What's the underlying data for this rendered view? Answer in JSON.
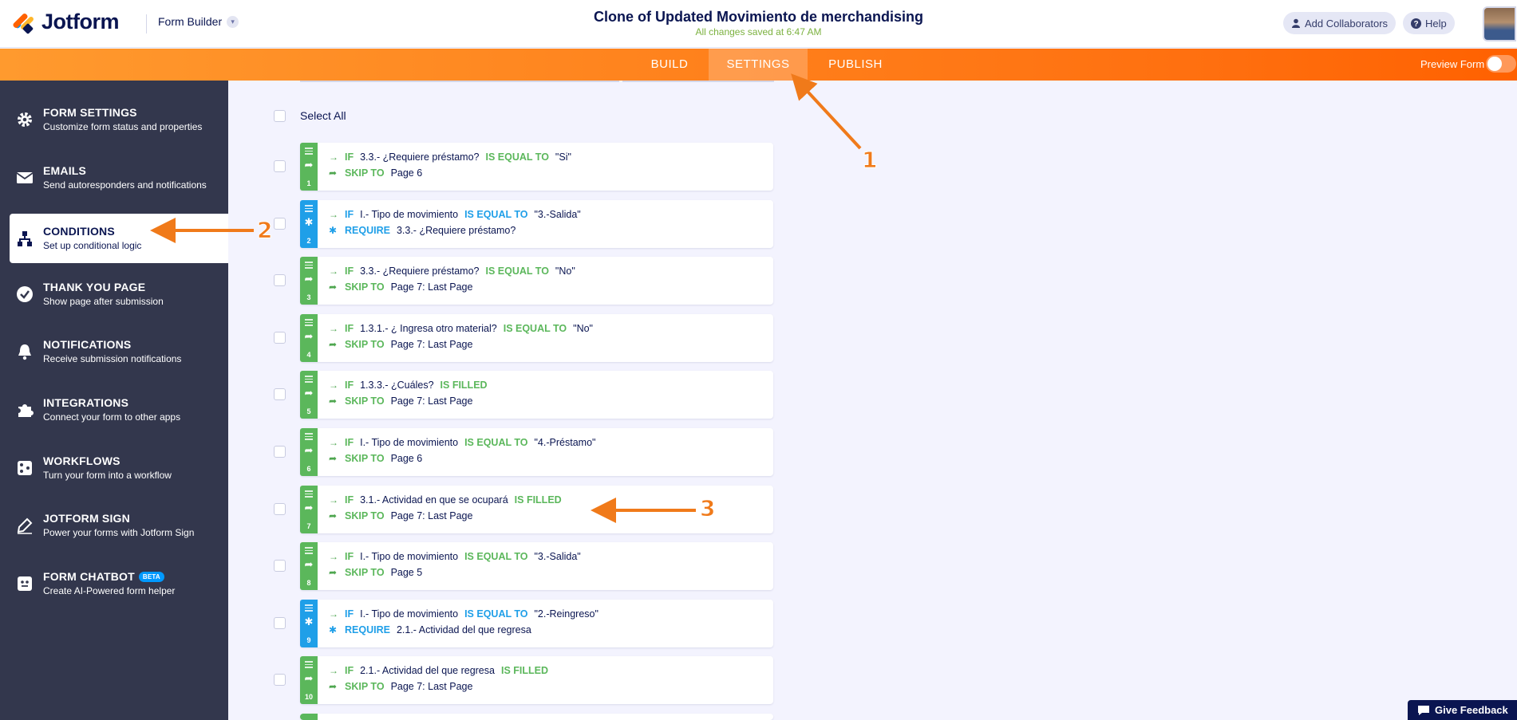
{
  "header": {
    "logo_text": "Jotform",
    "builder_label": "Form Builder",
    "form_title": "Clone of Updated Movimiento de merchandising",
    "saved_status": "All changes saved at 6:47 AM",
    "add_collaborators": "Add Collaborators",
    "help": "Help"
  },
  "nav": {
    "tabs": [
      "BUILD",
      "SETTINGS",
      "PUBLISH"
    ],
    "active_tab": "SETTINGS",
    "preview_label": "Preview Form"
  },
  "sidebar": {
    "items": [
      {
        "title": "FORM SETTINGS",
        "subtitle": "Customize form status and properties",
        "icon": "gear-icon"
      },
      {
        "title": "EMAILS",
        "subtitle": "Send autoresponders and notifications",
        "icon": "envelope-icon"
      },
      {
        "title": "CONDITIONS",
        "subtitle": "Set up conditional logic",
        "icon": "sitemap-icon"
      },
      {
        "title": "THANK YOU PAGE",
        "subtitle": "Show page after submission",
        "icon": "check-circle-icon"
      },
      {
        "title": "NOTIFICATIONS",
        "subtitle": "Receive submission notifications",
        "icon": "bell-icon"
      },
      {
        "title": "INTEGRATIONS",
        "subtitle": "Connect your form to other apps",
        "icon": "puzzle-icon"
      },
      {
        "title": "WORKFLOWS",
        "subtitle": "Turn your form into a workflow",
        "icon": "workflow-icon"
      },
      {
        "title": "JOTFORM SIGN",
        "subtitle": "Power your forms with Jotform Sign",
        "icon": "pen-icon"
      },
      {
        "title": "FORM CHATBOT",
        "subtitle": "Create AI-Powered form helper",
        "icon": "chatbot-icon",
        "badge": "BETA"
      }
    ],
    "active_item": "CONDITIONS"
  },
  "main": {
    "select_all": "Select All",
    "conditions": [
      {
        "num": "1",
        "type": "skip",
        "if_kw": "IF",
        "field": "3.3.- ¿Requiere préstamo?",
        "op": "IS EQUAL TO",
        "value": "\"Si\"",
        "action": "SKIP TO",
        "target": "Page 6"
      },
      {
        "num": "2",
        "type": "require",
        "if_kw": "IF",
        "field": "I.- Tipo de movimiento",
        "op": "IS EQUAL TO",
        "value": "\"3.-Salida\"",
        "action": "REQUIRE",
        "target": "3.3.- ¿Requiere préstamo?"
      },
      {
        "num": "3",
        "type": "skip",
        "if_kw": "IF",
        "field": "3.3.- ¿Requiere préstamo?",
        "op": "IS EQUAL TO",
        "value": "\"No\"",
        "action": "SKIP TO",
        "target": "Page 7: Last Page"
      },
      {
        "num": "4",
        "type": "skip",
        "if_kw": "IF",
        "field": "1.3.1.- ¿ Ingresa otro material?",
        "op": "IS EQUAL TO",
        "value": "\"No\"",
        "action": "SKIP TO",
        "target": "Page 7: Last Page"
      },
      {
        "num": "5",
        "type": "skip",
        "if_kw": "IF",
        "field": "1.3.3.- ¿Cuáles?",
        "op": "IS FILLED",
        "value": "",
        "action": "SKIP TO",
        "target": "Page 7: Last Page"
      },
      {
        "num": "6",
        "type": "skip",
        "if_kw": "IF",
        "field": "I.- Tipo de movimiento",
        "op": "IS EQUAL TO",
        "value": "\"4.-Préstamo\"",
        "action": "SKIP TO",
        "target": "Page 6"
      },
      {
        "num": "7",
        "type": "skip",
        "if_kw": "IF",
        "field": "3.1.- Actividad en que se ocupará",
        "op": "IS FILLED",
        "value": "",
        "action": "SKIP TO",
        "target": "Page 7: Last Page"
      },
      {
        "num": "8",
        "type": "skip",
        "if_kw": "IF",
        "field": "I.- Tipo de movimiento",
        "op": "IS EQUAL TO",
        "value": "\"3.-Salida\"",
        "action": "SKIP TO",
        "target": "Page 5"
      },
      {
        "num": "9",
        "type": "require",
        "if_kw": "IF",
        "field": "I.- Tipo de movimiento",
        "op": "IS EQUAL TO",
        "value": "\"2.-Reingreso\"",
        "action": "REQUIRE",
        "target": "2.1.- Actividad del que regresa"
      },
      {
        "num": "10",
        "type": "skip",
        "if_kw": "IF",
        "field": "2.1.- Actividad del que regresa",
        "op": "IS FILLED",
        "value": "",
        "action": "SKIP TO",
        "target": "Page 7: Last Page"
      }
    ]
  },
  "feedback": "Give Feedback",
  "annotations": [
    "1",
    "2",
    "3"
  ],
  "colors": {
    "orange": "#ff6f0f",
    "green": "#5bb75b",
    "blue": "#1f9fe8",
    "sidebar": "#33374d",
    "navy": "#0a1551"
  }
}
